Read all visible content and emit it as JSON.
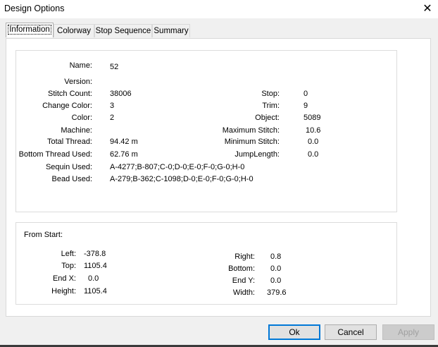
{
  "window": {
    "title": "Design Options"
  },
  "tabs": [
    "Information",
    "Colorway",
    "Stop Sequence",
    "Summary"
  ],
  "info": {
    "name_label": "Name:",
    "name": "52",
    "version_label": "Version:",
    "version": "",
    "stitch_count_label": "Stitch Count:",
    "stitch_count": "38006",
    "change_color_label": "Change Color:",
    "change_color": "3",
    "color_label": "Color:",
    "color": "2",
    "machine_label": "Machine:",
    "machine": "",
    "total_thread_label": "Total Thread:",
    "total_thread": "94.42 m",
    "bottom_thread_label": "Bottom Thread Used:",
    "bottom_thread": "62.76 m",
    "sequin_label": "Sequin Used:",
    "sequin": "A-4277;B-807;C-0;D-0;E-0;F-0;G-0;H-0",
    "bead_label": "Bead Used:",
    "bead": "A-279;B-362;C-1098;D-0;E-0;F-0;G-0;H-0",
    "stop_label": "Stop:",
    "stop": "0",
    "trim_label": "Trim:",
    "trim": "9",
    "object_label": "Object:",
    "object": "5089",
    "max_stitch_label": "Maximum Stitch:",
    "max_stitch": "10.6",
    "min_stitch_label": "Minimum Stitch:",
    "min_stitch": "0.0",
    "jump_label": "JumpLength:",
    "jump": "0.0"
  },
  "from_start": {
    "heading": "From Start:",
    "left_label": "Left:",
    "left": "-378.8",
    "top_label": "Top:",
    "top": "1105.4",
    "endx_label": "End X:",
    "endx": "0.0",
    "height_label": "Height:",
    "height": "1105.4",
    "right_label": "Right:",
    "right": "0.8",
    "bottom_label": "Bottom:",
    "bottom": "0.0",
    "endy_label": "End Y:",
    "endy": "0.0",
    "width_label": "Width:",
    "width": "379.6"
  },
  "buttons": {
    "ok": "Ok",
    "cancel": "Cancel",
    "apply": "Apply"
  },
  "colors": {
    "accent": "#0078d7",
    "disabled_text": "#a0a0a0"
  }
}
